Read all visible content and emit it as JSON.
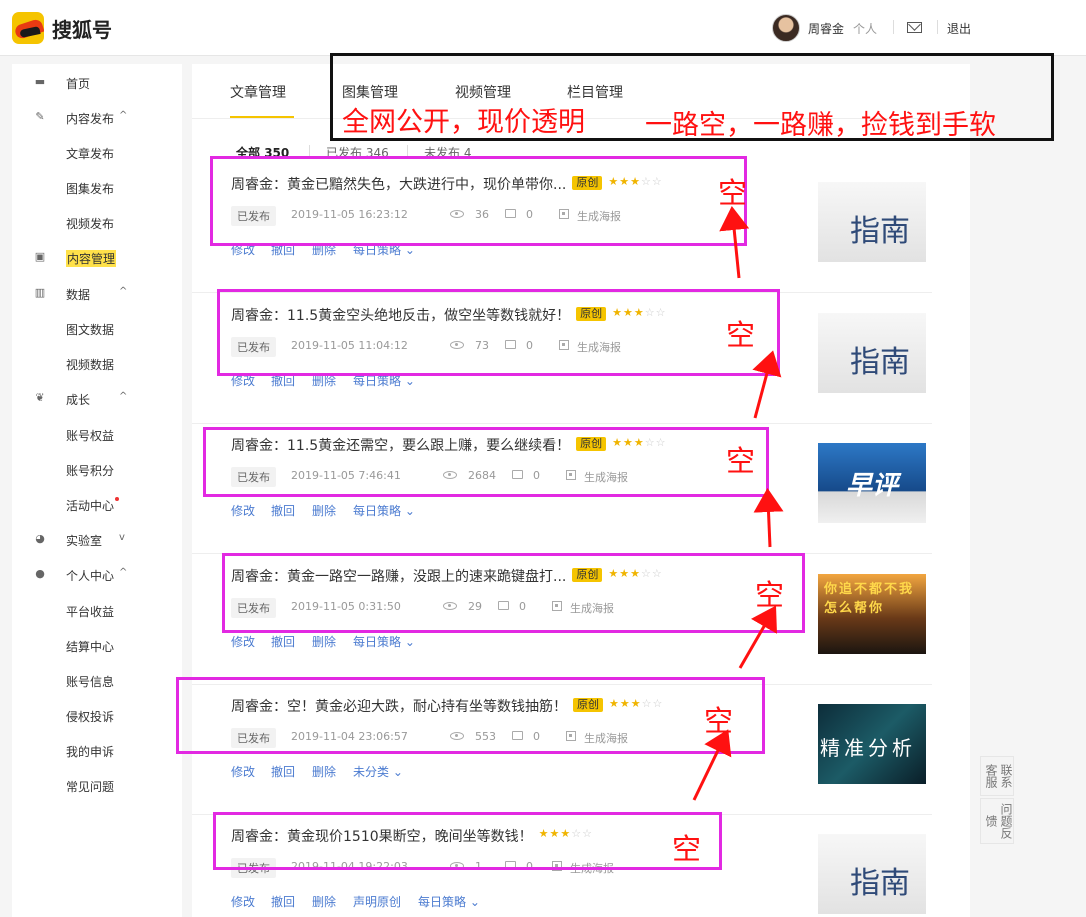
{
  "header": {
    "brand": "搜狐号",
    "user_name": "周睿金",
    "user_role": "个人",
    "logout": "退出"
  },
  "sidebar": {
    "items": [
      {
        "label": "首页",
        "icon": "monitor-icon"
      },
      {
        "label": "内容发布",
        "icon": "pencil-icon",
        "caret": "^"
      },
      {
        "label": "文章发布"
      },
      {
        "label": "图集发布"
      },
      {
        "label": "视频发布"
      },
      {
        "label": "内容管理",
        "icon": "document-icon"
      },
      {
        "label": "数据",
        "icon": "bar-chart-icon",
        "caret": "^"
      },
      {
        "label": "图文数据"
      },
      {
        "label": "视频数据"
      },
      {
        "label": "成长",
        "icon": "leaf-icon",
        "caret": "^"
      },
      {
        "label": "账号权益"
      },
      {
        "label": "账号积分"
      },
      {
        "label": "活动中心"
      },
      {
        "label": "实验室",
        "icon": "lab-icon",
        "caret": "v"
      },
      {
        "label": "个人中心",
        "icon": "person-icon",
        "caret": "^"
      },
      {
        "label": "平台收益"
      },
      {
        "label": "结算中心"
      },
      {
        "label": "账号信息"
      },
      {
        "label": "侵权投诉"
      },
      {
        "label": "我的申诉"
      },
      {
        "label": "常见问题"
      }
    ]
  },
  "tabs": [
    "文章管理",
    "图集管理",
    "视频管理",
    "栏目管理"
  ],
  "filters": [
    {
      "label": "全部",
      "count": "350"
    },
    {
      "label": "已发布",
      "count": "346"
    },
    {
      "label": "未发布",
      "count": "4"
    }
  ],
  "articles": [
    {
      "title": "周睿金：黄金已黯然失色，大跌进行中，现价单带你...",
      "original": "原创",
      "stars": "★★★☆☆",
      "status": "已发布",
      "time": "2019-11-05 16:23:12",
      "views": "36",
      "comments": "0",
      "poster": "生成海报",
      "actions": [
        "修改",
        "撤回",
        "删除",
        "每日策略 ⌄"
      ],
      "thumb": "guide",
      "thumb_text": "指南"
    },
    {
      "title": "周睿金：11.5黄金空头绝地反击，做空坐等数钱就好！",
      "original": "原创",
      "stars": "★★★☆☆",
      "status": "已发布",
      "time": "2019-11-05 11:04:12",
      "views": "73",
      "comments": "0",
      "poster": "生成海报",
      "actions": [
        "修改",
        "撤回",
        "删除",
        "每日策略 ⌄"
      ],
      "thumb": "guide",
      "thumb_text": "指南"
    },
    {
      "title": "周睿金：11.5黄金还需空，要么跟上赚，要么继续看！",
      "original": "原创",
      "stars": "★★★☆☆",
      "status": "已发布",
      "time": "2019-11-05 7:46:41",
      "views": "2684",
      "comments": "0",
      "poster": "生成海报",
      "actions": [
        "修改",
        "撤回",
        "删除",
        "每日策略 ⌄"
      ],
      "thumb": "review",
      "thumb_text": "早评"
    },
    {
      "title": "周睿金：黄金一路空一路赚，没跟上的速来跪键盘打...",
      "original": "原创",
      "stars": "★★★☆☆",
      "status": "已发布",
      "time": "2019-11-05 0:31:50",
      "views": "29",
      "comments": "0",
      "poster": "生成海报",
      "actions": [
        "修改",
        "撤回",
        "删除",
        "每日策略 ⌄"
      ],
      "thumb": "climb",
      "thumb_text": "你追不都不我怎么帮你"
    },
    {
      "title": "周睿金：空！黄金必迎大跌，耐心持有坐等数钱抽筋！",
      "original": "原创",
      "stars": "★★★☆☆",
      "status": "已发布",
      "time": "2019-11-04 23:06:57",
      "views": "553",
      "comments": "0",
      "poster": "生成海报",
      "actions": [
        "修改",
        "撤回",
        "删除",
        "未分类 ⌄"
      ],
      "thumb": "precise",
      "thumb_text": "精准分析"
    },
    {
      "title": "周睿金：黄金现价1510果断空，晚间坐等数钱！",
      "original": "",
      "stars": "★★★☆☆",
      "status": "已发布",
      "time": "2019-11-04 19:22:03",
      "views": "1",
      "comments": "0",
      "poster": "生成海报",
      "actions": [
        "修改",
        "撤回",
        "删除",
        "声明原创",
        "每日策略 ⌄"
      ],
      "thumb": "guide",
      "thumb_text": "指南"
    }
  ],
  "annotations": {
    "headline_left": "全网公开，现价透明",
    "headline_right": "一路空，一路赚，捡钱到手软",
    "marker": "空"
  },
  "side_buttons": [
    "联系客服",
    "问题反馈"
  ],
  "colors": {
    "accent": "#f5c400",
    "link": "#4b7bd0",
    "annotation_box": "#e229e2",
    "annotation_text": "#ff1111"
  }
}
